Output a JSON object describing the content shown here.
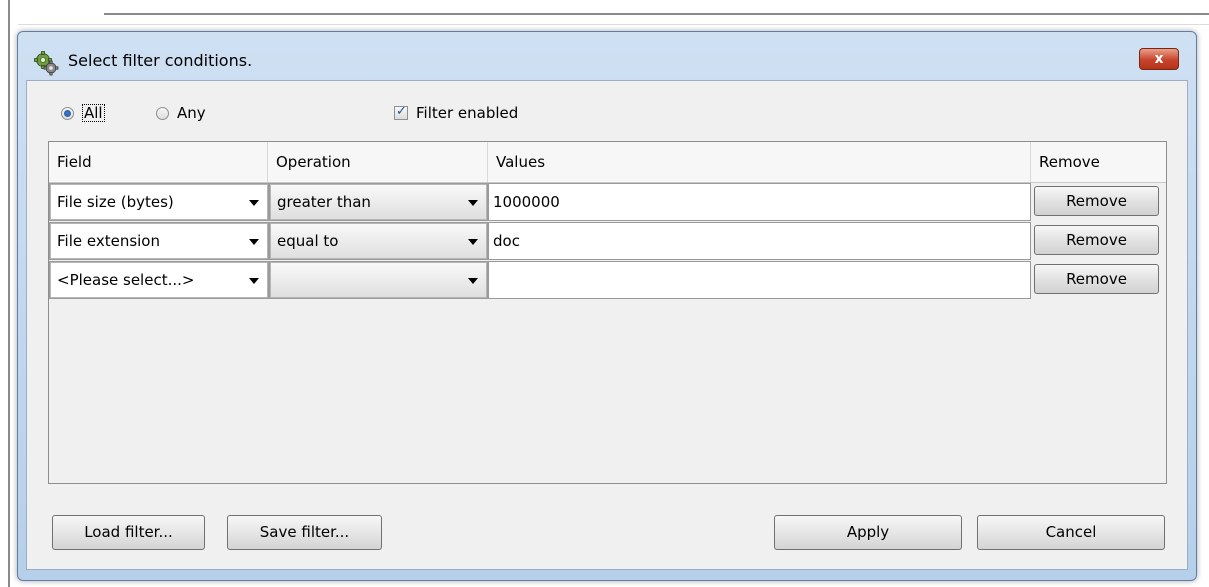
{
  "dialog": {
    "title": "Select filter conditions.",
    "close_label": "x",
    "match": {
      "all_label": "All",
      "any_label": "Any",
      "selected": "All"
    },
    "filter_enabled_label": "Filter enabled",
    "filter_enabled_checked": true,
    "table": {
      "columns": [
        "Field",
        "Operation",
        "Values",
        "Remove"
      ],
      "rows": [
        {
          "field": "File size (bytes)",
          "operation": "greater than",
          "value": "1000000",
          "remove_label": "Remove"
        },
        {
          "field": "File extension",
          "operation": "equal to",
          "value": "doc",
          "remove_label": "Remove"
        },
        {
          "field": "<Please select...>",
          "operation": "",
          "value": "",
          "remove_label": "Remove"
        }
      ]
    },
    "buttons": {
      "load": "Load filter...",
      "save": "Save filter...",
      "apply": "Apply",
      "cancel": "Cancel"
    }
  }
}
